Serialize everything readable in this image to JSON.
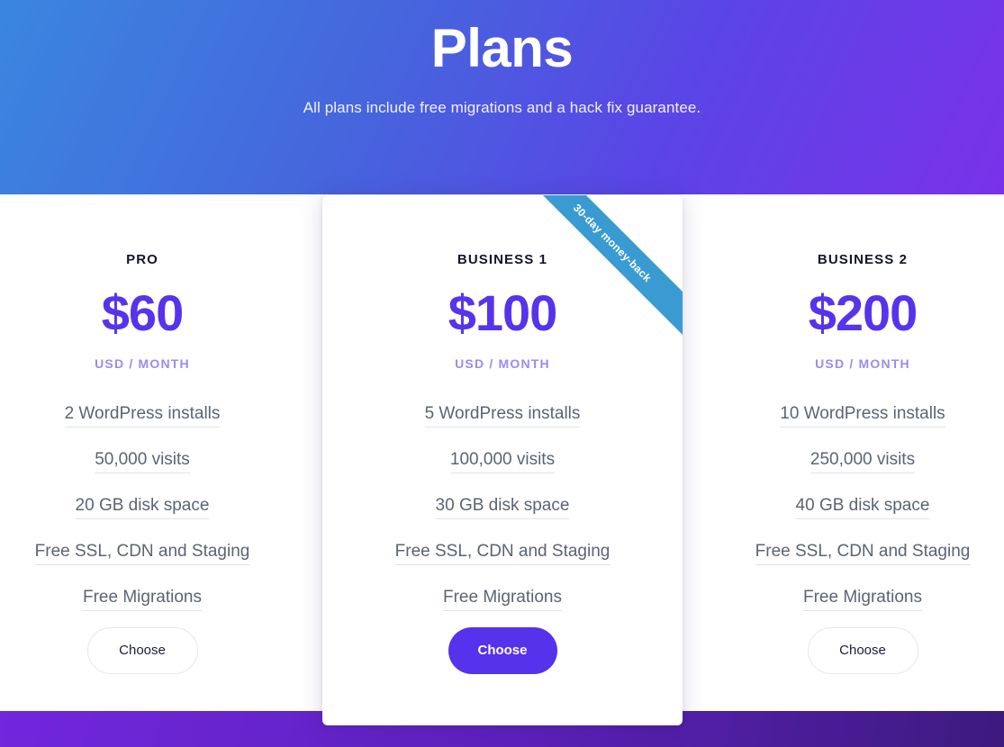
{
  "hero": {
    "title": "Plans",
    "subtitle": "All plans include free migrations and a hack fix guarantee.",
    "gradient_from": "#3a86df",
    "gradient_to": "#7a32e9"
  },
  "footer": {
    "band_color_from": "#7127dd",
    "band_color_to": "#3d1a7e"
  },
  "colors": {
    "price_purple": "#5633ec",
    "period_purple": "#9b8cf1",
    "plan_name_dark": "#121330",
    "feature_text": "#5b6474",
    "feature_underline": "#dfe2ea",
    "ribbon_blue": "#3a9bd2",
    "button_solid_bg": "#5532ec",
    "button_outline_border": "#e6e8f1",
    "card_bg": "#ffffff"
  },
  "plans": [
    {
      "name": "PRO",
      "price": "$60",
      "period": "USD / MONTH",
      "featured": false,
      "features": [
        "2 WordPress installs",
        "50,000 visits",
        "20 GB disk space",
        "Free SSL, CDN and Staging",
        "Free Migrations"
      ],
      "cta": "Choose"
    },
    {
      "name": "BUSINESS 1",
      "price": "$100",
      "period": "USD / MONTH",
      "featured": true,
      "ribbon": "30-day money-back",
      "features": [
        "5 WordPress installs",
        "100,000 visits",
        "30 GB disk space",
        "Free SSL, CDN and Staging",
        "Free Migrations"
      ],
      "cta": "Choose"
    },
    {
      "name": "BUSINESS 2",
      "price": "$200",
      "period": "USD / MONTH",
      "featured": false,
      "features": [
        "10 WordPress installs",
        "250,000 visits",
        "40 GB disk space",
        "Free SSL, CDN and Staging",
        "Free Migrations"
      ],
      "cta": "Choose"
    }
  ]
}
